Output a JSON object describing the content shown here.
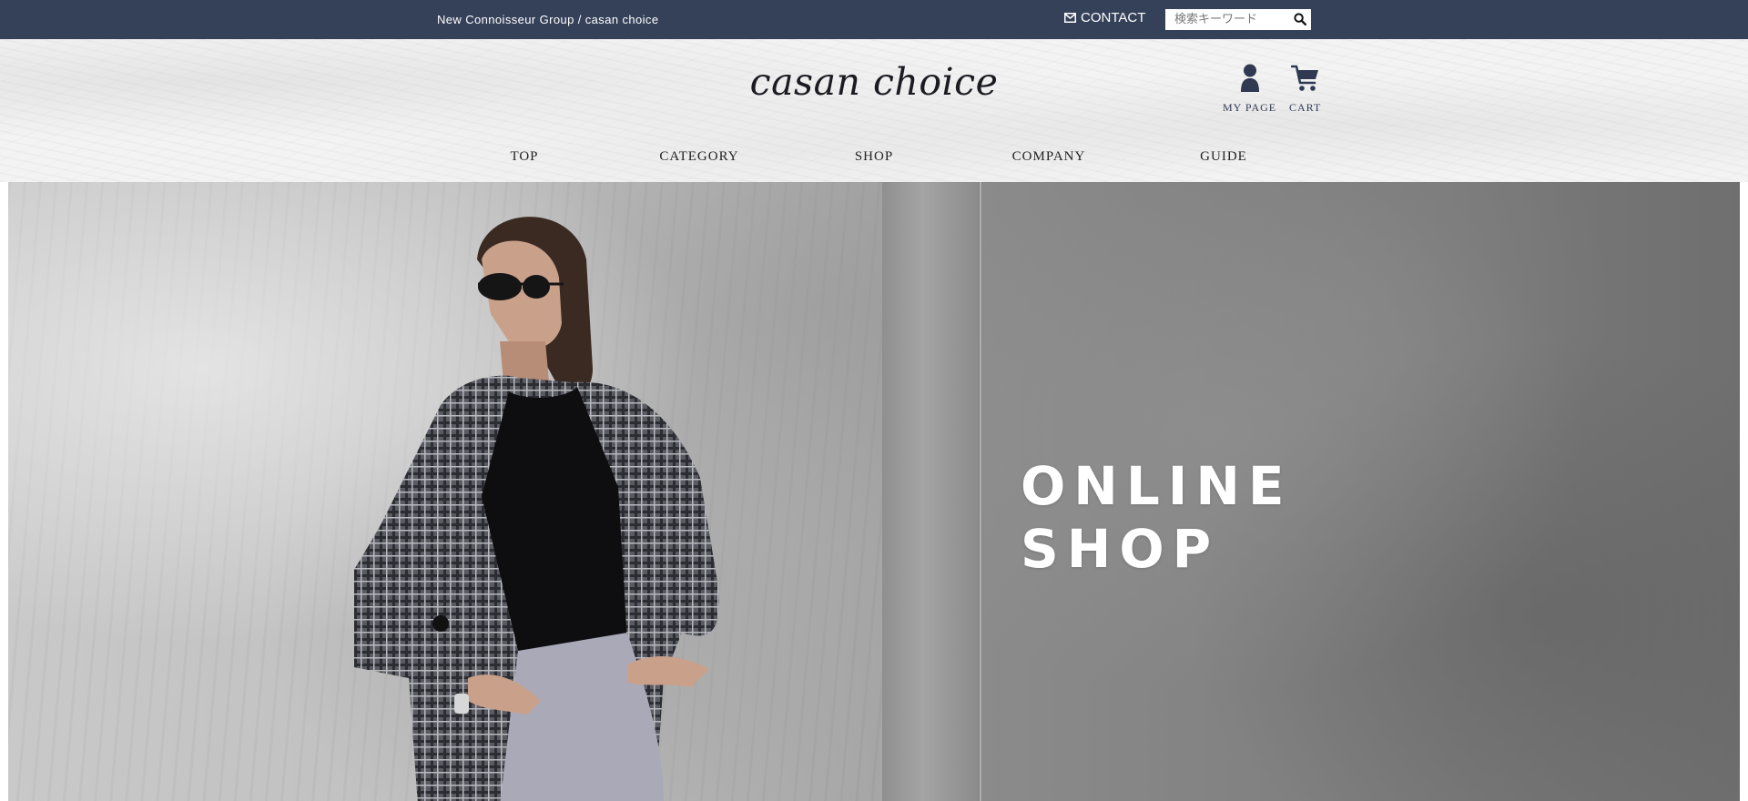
{
  "topbar": {
    "breadcrumb": "New Connoisseur Group / casan choice",
    "contact_label": "CONTACT",
    "search_placeholder": "検索キーワード",
    "background_color": "#354059",
    "icons": {
      "contact": "envelope-icon",
      "search": "search-icon"
    }
  },
  "header": {
    "logo_text": "casan choice",
    "mypage_label": "MY PAGE",
    "cart_label": "CART",
    "icons": {
      "mypage": "user-icon",
      "cart": "cart-icon"
    },
    "accent_color": "#2f3a52"
  },
  "nav": {
    "items": [
      {
        "label": "TOP"
      },
      {
        "label": "CATEGORY"
      },
      {
        "label": "SHOP"
      },
      {
        "label": "COMPANY"
      },
      {
        "label": "GUIDE"
      }
    ]
  },
  "hero": {
    "title_line1": "ONLINE",
    "title_line2": "SHOP"
  }
}
